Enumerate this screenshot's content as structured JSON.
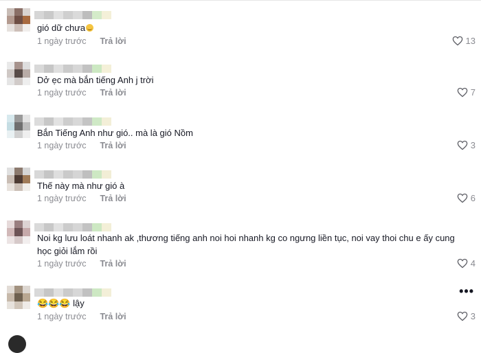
{
  "comments": [
    {
      "text": "gió dữ chưa",
      "emoji_suffix": "grin",
      "date": "1 ngày trước",
      "reply": "Trả lời",
      "likes": "13"
    },
    {
      "text": "Dở ẹc mà bắn tiếng Anh j trời",
      "date": "1 ngày trước",
      "reply": "Trả lời",
      "likes": "7"
    },
    {
      "text": "Bắn Tiếng Anh như gió.. mà là gió Nồm",
      "date": "1 ngày trước",
      "reply": "Trả lời",
      "likes": "3"
    },
    {
      "text": "Thế này mà như gió à",
      "date": "1 ngày trước",
      "reply": "Trả lời",
      "likes": "6"
    },
    {
      "text": "Noi kg lưu loát nhanh ak ,thương tiếng anh noi hoi nhanh kg co ngưng liền tục, noi vay thoi chu e ấy cung học giỏi lắm rồi",
      "date": "1 ngày trước",
      "reply": "Trả lời",
      "likes": "4"
    },
    {
      "text": "😂😂😂 lậy",
      "date": "1 ngày trước",
      "reply": "Trả lời",
      "likes": "3",
      "more": "•••"
    }
  ],
  "colors": {
    "text": "#161823",
    "muted": "#8a8b91"
  },
  "icons": {
    "like": "heart-outline-icon",
    "more": "more-dots-icon"
  }
}
